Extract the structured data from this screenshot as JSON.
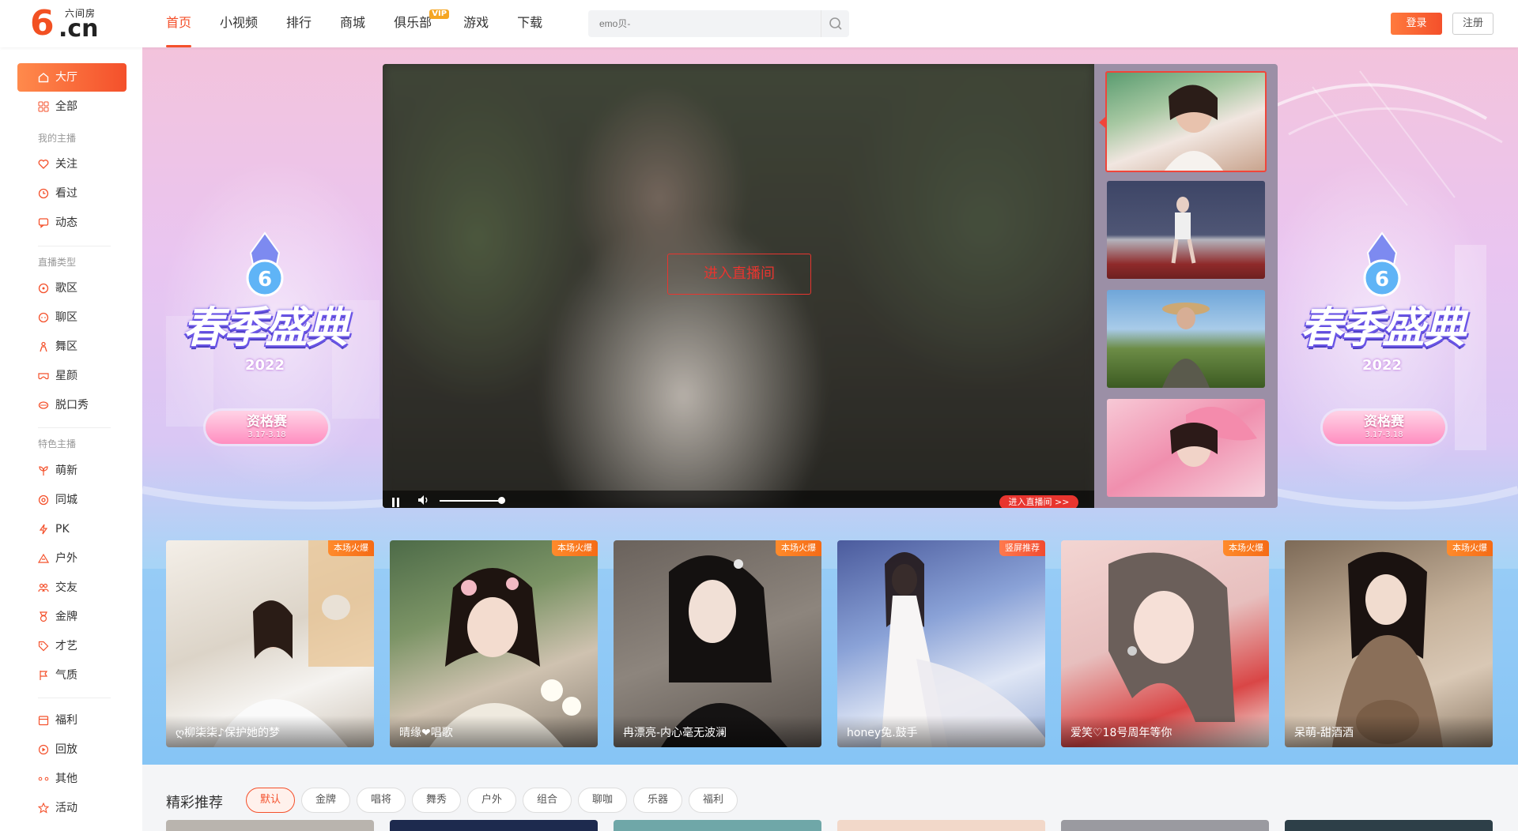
{
  "header": {
    "logo_main": "6",
    "logo_suffix": ".cn",
    "logo_name": "六间房",
    "nav": [
      "首页",
      "小视频",
      "排行",
      "商城",
      "俱乐部",
      "游戏",
      "下载"
    ],
    "vip_badge": "VIP",
    "search_placeholder": "emo贝-",
    "login": "登录",
    "register": "注册"
  },
  "sidebar": {
    "items": [
      "大厅",
      "全部"
    ],
    "group_my": "我的主播",
    "my_items": [
      "关注",
      "看过",
      "动态"
    ],
    "group_type": "直播类型",
    "type_items": [
      "歌区",
      "聊区",
      "舞区",
      "星颜",
      "脱口秀"
    ],
    "group_special": "特色主播",
    "special_items": [
      "萌新",
      "同城",
      "PK",
      "户外",
      "交友",
      "金牌",
      "才艺",
      "气质"
    ],
    "bottom_items": [
      "福利",
      "回放",
      "其他",
      "活动"
    ]
  },
  "banner": {
    "event_title": "春季盛典",
    "event_year": "2022",
    "event_stage": "资格赛",
    "event_dates": "3.17-3.18"
  },
  "player": {
    "enter_room": "进入直播间",
    "enter_room_small": "进入直播间 >>"
  },
  "cards": [
    {
      "tag": "本场火爆",
      "name": "ღ柳柒柒♪保护她的梦"
    },
    {
      "tag": "本场火爆",
      "name": "晴缘❤唱歌"
    },
    {
      "tag": "本场火爆",
      "name": "冉漂亮-内心毫无波澜"
    },
    {
      "tag": "竖屏推荐",
      "name": "honey兔.鼓手"
    },
    {
      "tag": "本场火爆",
      "name": "爱笑♡18号周年等你"
    },
    {
      "tag": "本场火爆",
      "name": "呆萌-甜酒酒"
    }
  ],
  "recommend": {
    "title": "精彩推荐",
    "chips": [
      "默认",
      "金牌",
      "唱将",
      "舞秀",
      "户外",
      "组合",
      "聊咖",
      "乐器",
      "福利"
    ]
  }
}
